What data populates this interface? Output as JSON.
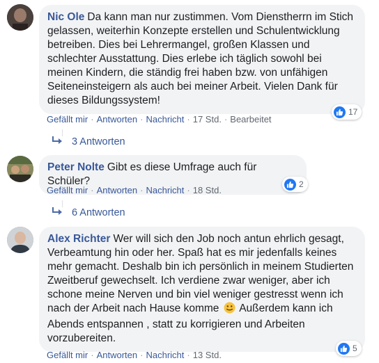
{
  "comments": [
    {
      "author": "Nic Ole",
      "text": "Da kann man nur zustimmen. Vom Dienstherrn im Stich gelassen, weiterhin Konzepte erstellen und Schulentwicklung betreiben. Dies bei Lehrermangel, großen Klassen und schlechter Ausstattung. Dies erlebe ich täglich sowohl bei meinen Kindern, die ständig frei haben bzw. von unfähigen Seiteneinsteigern als auch bei meiner Arbeit. Vielen Dank für dieses Bildungssystem!",
      "like_count": "17",
      "actions": {
        "like": "Gefällt mir",
        "reply": "Antworten",
        "message": "Nachricht",
        "time": "17 Std.",
        "edited": "Bearbeitet"
      },
      "replies_label": "3 Antworten"
    },
    {
      "author": "Peter Nolte",
      "text": "Gibt es diese Umfrage auch für Schüler?",
      "like_count": "2",
      "actions": {
        "like": "Gefällt mir",
        "reply": "Antworten",
        "message": "Nachricht",
        "time": "18 Std."
      },
      "replies_label": "6 Antworten"
    },
    {
      "author": "Alex Richter",
      "text_before_emoji": "Wer will sich den Job noch antun ehrlich gesagt, Verbeamtung hin oder her. Spaß hat es mir jedenfalls keines mehr gemacht. Deshalb bin ich persönlich in meinem Studierten Zweitberuf gewechselt. Ich verdiene zwar weniger, aber ich schone meine Nerven und bin viel weniger gestresst wenn ich nach der Arbeit nach Hause komme",
      "text_after_emoji": "Außerdem kann ich Abends entspannen , statt zu korrigieren und Arbeiten vorzubereiten.",
      "like_count": "5",
      "actions": {
        "like": "Gefällt mir",
        "reply": "Antworten",
        "message": "Nachricht",
        "time": "13 Std."
      }
    }
  ],
  "colors": {
    "author": "#385898",
    "bubble": "#f2f3f5",
    "like": "#2078f4",
    "meta": "#606770"
  }
}
